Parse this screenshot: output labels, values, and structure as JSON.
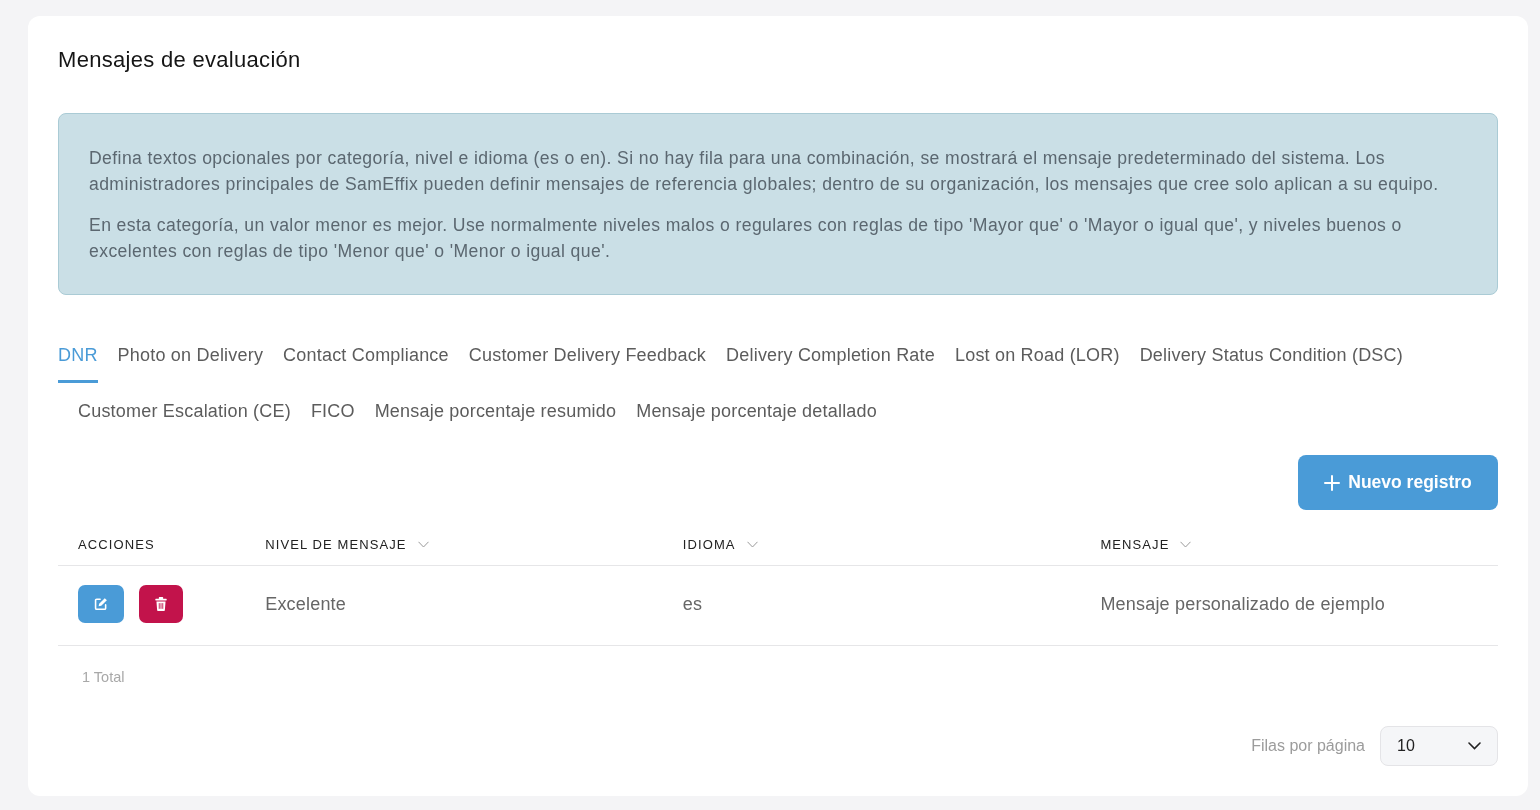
{
  "page": {
    "title": "Mensajes de evaluación"
  },
  "info": {
    "paragraphs": [
      "Defina textos opcionales por categoría, nivel e idioma (es o en). Si no hay fila para una combinación, se mostrará el mensaje predeterminado del sistema. Los administradores principales de SamEffix pueden definir mensajes de referencia globales; dentro de su organización, los mensajes que cree solo aplican a su equipo.",
      "En esta categoría, un valor menor es mejor. Use normalmente niveles malos o regulares con reglas de tipo 'Mayor que' o 'Mayor o igual que', y niveles buenos o excelentes con reglas de tipo 'Menor que' o 'Menor o igual que'."
    ]
  },
  "tabs": [
    {
      "label": "DNR",
      "selected": true
    },
    {
      "label": "Photo on Delivery",
      "selected": false
    },
    {
      "label": "Contact Compliance",
      "selected": false
    },
    {
      "label": "Customer Delivery Feedback",
      "selected": false
    },
    {
      "label": "Delivery Completion Rate",
      "selected": false
    },
    {
      "label": "Lost on Road (LOR)",
      "selected": false
    },
    {
      "label": "Delivery Status Condition (DSC)",
      "selected": false
    },
    {
      "label": "Customer Escalation (CE)",
      "selected": false
    },
    {
      "label": "FICO",
      "selected": false
    },
    {
      "label": "Mensaje porcentaje resumido",
      "selected": false
    },
    {
      "label": "Mensaje porcentaje detallado",
      "selected": false
    }
  ],
  "new_button": {
    "label": "Nuevo registro"
  },
  "table": {
    "actions_header": "ACCIONES",
    "columns": [
      {
        "label": "NIVEL DE MENSAJE",
        "sortable": true
      },
      {
        "label": "IDIOMA",
        "sortable": true
      },
      {
        "label": "MENSAJE",
        "sortable": true
      }
    ],
    "rows": [
      {
        "cells": [
          "Excelente",
          "es",
          "Mensaje personalizado de ejemplo"
        ]
      }
    ]
  },
  "footer": {
    "total": "1 Total",
    "rows_per_page_label": "Filas por página",
    "rows_per_page_value": "10"
  }
}
